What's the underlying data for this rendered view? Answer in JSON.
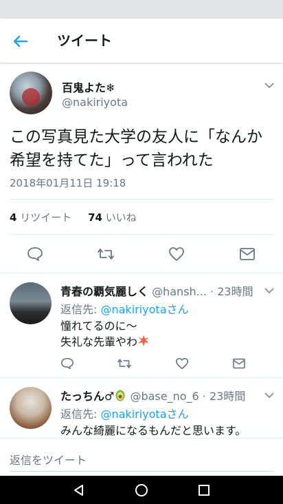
{
  "appbar": {
    "title": "ツイート",
    "back_icon": "back-arrow-icon",
    "accent": "#1da1f2"
  },
  "tweet": {
    "display_name": "百鬼よた❄",
    "handle": "@nakiriyota",
    "text": "この写真見た大学の友人に「なんか希望を持てた」って言われた",
    "timestamp": "2018年01月11日 19:18",
    "retweet_count": "4",
    "retweet_label": "リツイート",
    "like_count": "74",
    "like_label": "いいね",
    "action_icons": [
      "reply-icon",
      "retweet-icon",
      "like-icon",
      "dm-icon"
    ]
  },
  "replies": [
    {
      "name": "青春の覇気麗しく",
      "handle": "@hansh...",
      "time": "· 23時間",
      "reply_to_prefix": "返信先: ",
      "reply_to_handle": "@nakiriyotaさん",
      "lines": [
        "憧れてるのに〜",
        "失礼な先輩やわ"
      ],
      "emoji": "anger-symbol-emoji"
    },
    {
      "name": "たっちん♂",
      "handle": "@base_no_6",
      "time": "· 23時間",
      "reply_to_prefix": "返信先: ",
      "reply_to_handle": "@nakiriyotaさん",
      "lines": [
        "みんな綺麗になるもんだと思います。"
      ],
      "emoji": "avocado-emoji"
    }
  ],
  "compose": {
    "placeholder": "返信をツイート"
  },
  "navbar": {
    "icons": [
      "nav-back-icon",
      "nav-home-icon",
      "nav-recents-icon"
    ]
  }
}
